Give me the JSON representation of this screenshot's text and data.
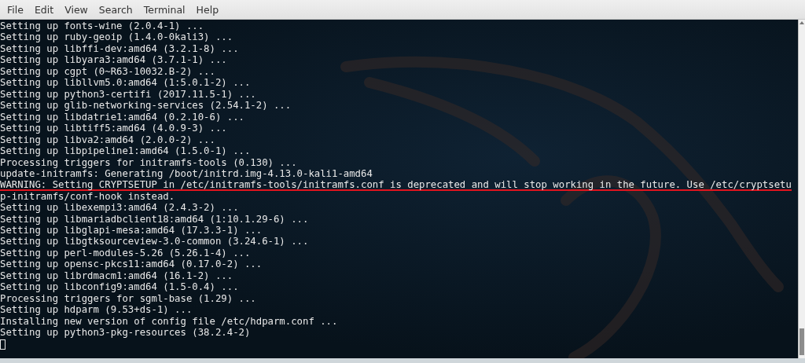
{
  "menu": [
    "File",
    "Edit",
    "View",
    "Search",
    "Terminal",
    "Help"
  ],
  "terminal": {
    "lines": [
      {
        "text": "Setting up fonts-wine (2.0.4-1) ...",
        "underlined": false
      },
      {
        "text": "Setting up ruby-geoip (1.4.0-0kali3) ...",
        "underlined": false
      },
      {
        "text": "Setting up libffi-dev:amd64 (3.2.1-8) ...",
        "underlined": false
      },
      {
        "text": "Setting up libyara3:amd64 (3.7.1-1) ...",
        "underlined": false
      },
      {
        "text": "Setting up cgpt (0~R63-10032.B-2) ...",
        "underlined": false
      },
      {
        "text": "Setting up libllvm5.0:amd64 (1:5.0.1-2) ...",
        "underlined": false
      },
      {
        "text": "Setting up python3-certifi (2017.11.5-1) ...",
        "underlined": false
      },
      {
        "text": "Setting up glib-networking-services (2.54.1-2) ...",
        "underlined": false
      },
      {
        "text": "Setting up libdatrie1:amd64 (0.2.10-6) ...",
        "underlined": false
      },
      {
        "text": "Setting up libtiff5:amd64 (4.0.9-3) ...",
        "underlined": false
      },
      {
        "text": "Setting up libva2:amd64 (2.0.0-2) ...",
        "underlined": false
      },
      {
        "text": "Setting up libpipeline1:amd64 (1.5.0-1) ...",
        "underlined": false
      },
      {
        "text": "Processing triggers for initramfs-tools (0.130) ...",
        "underlined": false
      },
      {
        "text": "update-initramfs: Generating /boot/initrd.img-4.13.0-kali1-amd64",
        "underlined": false
      },
      {
        "text": "WARNING: Setting CRYPTSETUP in /etc/initramfs-tools/initramfs.conf is deprecated and will stop working in the future. Use /etc/cryptsetu",
        "underlined": true
      },
      {
        "text": "p-initramfs/conf-hook instead.",
        "underlined": false
      },
      {
        "text": "Setting up libexempi3:amd64 (2.4.3-2) ...",
        "underlined": false
      },
      {
        "text": "Setting up libmariadbclient18:amd64 (1:10.1.29-6) ...",
        "underlined": false
      },
      {
        "text": "Setting up libglapi-mesa:amd64 (17.3.3-1) ...",
        "underlined": false
      },
      {
        "text": "Setting up libgtksourceview-3.0-common (3.24.6-1) ...",
        "underlined": false
      },
      {
        "text": "Setting up perl-modules-5.26 (5.26.1-4) ...",
        "underlined": false
      },
      {
        "text": "Setting up opensc-pkcs11:amd64 (0.17.0-2) ...",
        "underlined": false
      },
      {
        "text": "Setting up librdmacm1:amd64 (16.1-2) ...",
        "underlined": false
      },
      {
        "text": "Setting up libconfig9:amd64 (1.5-0.4) ...",
        "underlined": false
      },
      {
        "text": "Processing triggers for sgml-base (1.29) ...",
        "underlined": false
      },
      {
        "text": "Setting up hdparm (9.53+ds-1) ...",
        "underlined": false
      },
      {
        "text": "Installing new version of config file /etc/hdparm.conf ...",
        "underlined": false
      },
      {
        "text": "Setting up python3-pkg-resources (38.2.4-2)",
        "underlined": false
      }
    ]
  }
}
